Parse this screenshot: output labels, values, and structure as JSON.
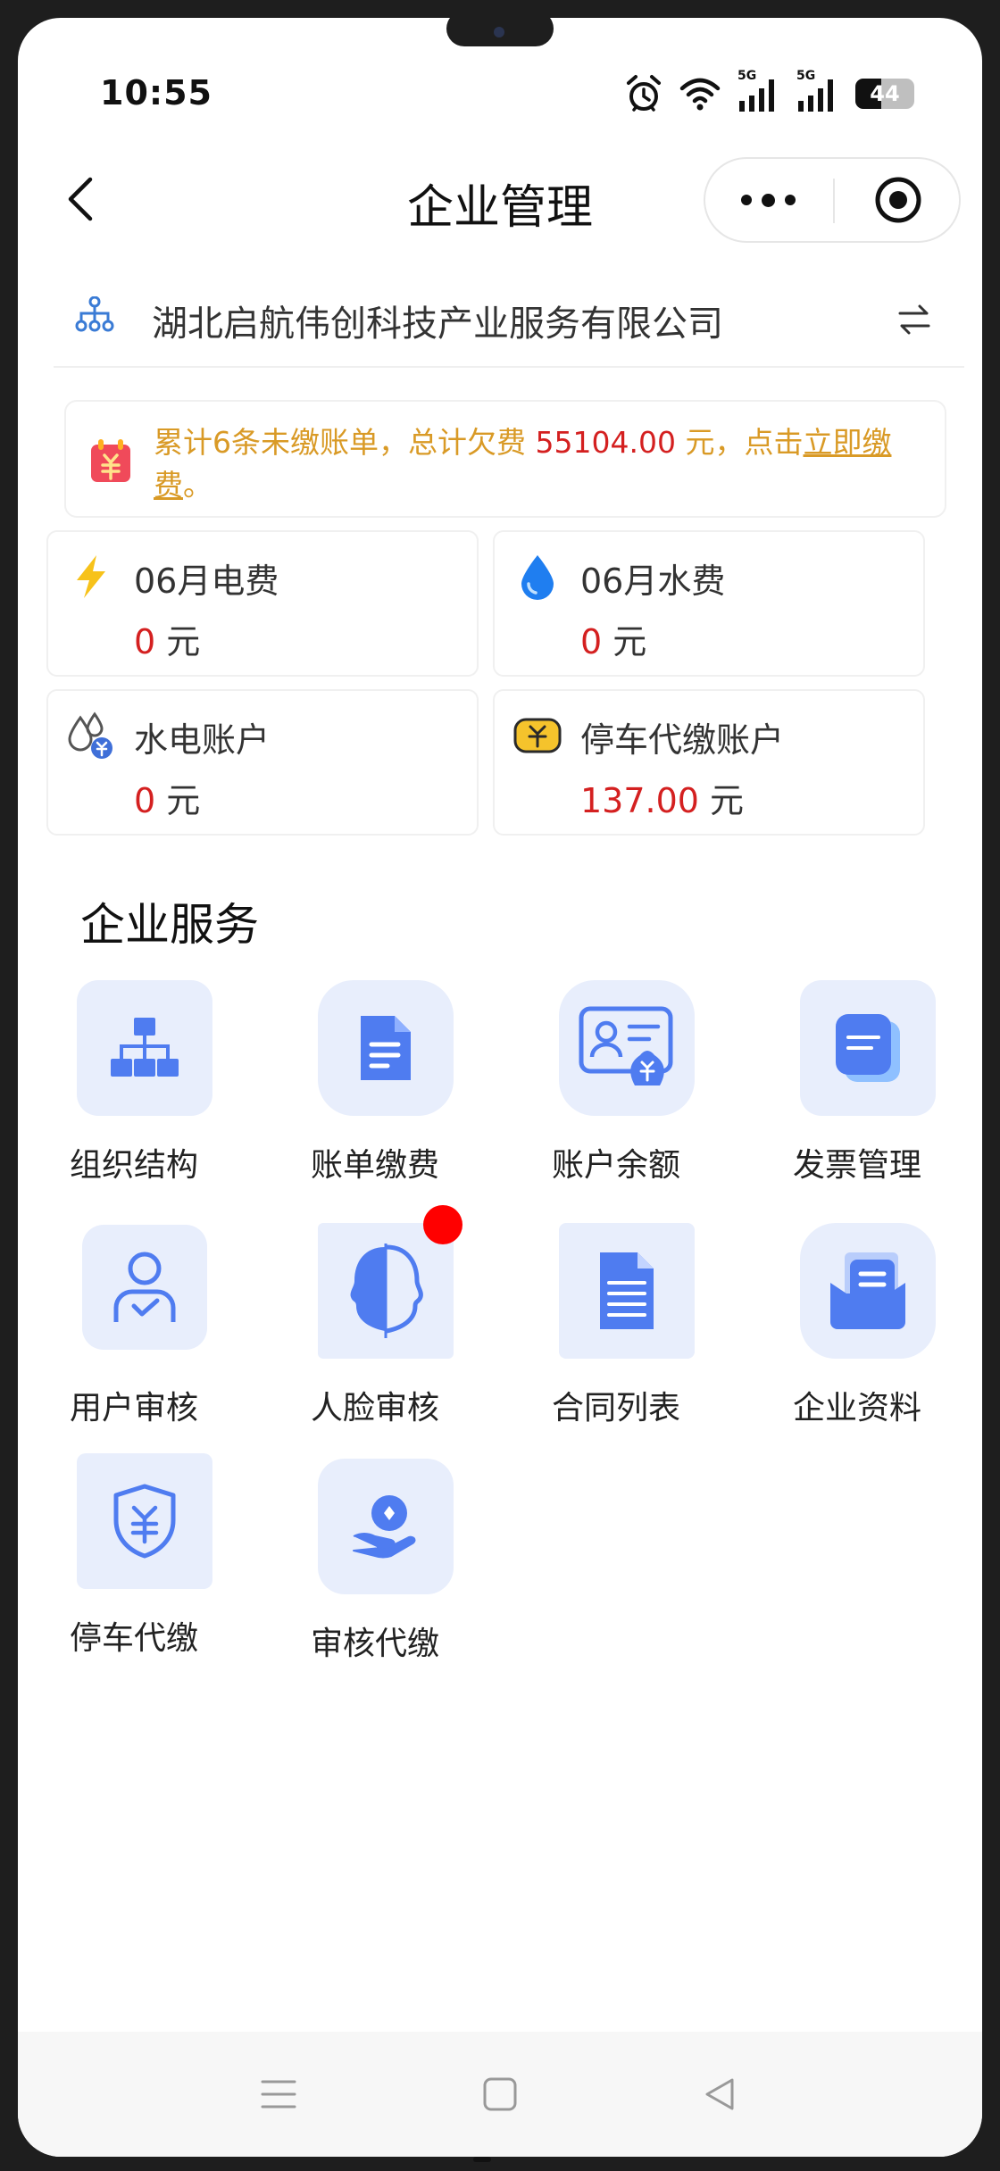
{
  "status_bar": {
    "time": "10:55",
    "net1": "5G",
    "net2": "5G",
    "battery": "44",
    "icons": [
      "alarm-icon",
      "wifi-icon",
      "signal-5g-icon",
      "signal-5g-icon",
      "battery-icon"
    ]
  },
  "nav": {
    "title": "企业管理",
    "back_icon": "chevron-left-icon",
    "more_icon": "more-dots-icon",
    "close_icon": "target-close-icon"
  },
  "company": {
    "name": "湖北启航伟创科技产业服务有限公司",
    "icon": "org-tree-icon",
    "switch_icon": "switch-arrows-icon"
  },
  "notice": {
    "prefix": "累计6条未缴账单，总计欠费 ",
    "amount": "55104.00",
    "middle": " 元，点击",
    "link": "立即缴费",
    "suffix": "。",
    "icon": "bill-calendar-icon"
  },
  "cards": [
    {
      "title": "06月电费",
      "value": "0",
      "unit": " 元",
      "icon": "lightning-icon"
    },
    {
      "title": "06月水费",
      "value": "0",
      "unit": " 元",
      "icon": "water-drop-icon"
    },
    {
      "title": "水电账户",
      "value": "0",
      "unit": " 元",
      "icon": "water-electric-account-icon"
    },
    {
      "title": "停车代缴账户",
      "value": "137.00",
      "unit": " 元",
      "icon": "parking-wallet-icon"
    }
  ],
  "services": {
    "title": "企业服务",
    "items": [
      {
        "label": "组织结构",
        "icon": "org-structure-icon"
      },
      {
        "label": "账单缴费",
        "icon": "bill-document-icon"
      },
      {
        "label": "账户余额",
        "icon": "account-balance-icon"
      },
      {
        "label": "发票管理",
        "icon": "invoice-icon"
      },
      {
        "label": "用户审核",
        "icon": "user-check-icon"
      },
      {
        "label": "人脸审核",
        "icon": "face-icon"
      },
      {
        "label": "合同列表",
        "icon": "contract-icon"
      },
      {
        "label": "企业资料",
        "icon": "enterprise-docs-icon"
      },
      {
        "label": "停车代缴",
        "icon": "shield-yuan-icon"
      },
      {
        "label": "审核代缴",
        "icon": "hand-coin-icon"
      }
    ]
  },
  "colors": {
    "accent_blue": "#4f7cf0",
    "tile_bg": "#e8eefc",
    "warning_text": "#d99a26",
    "amount_red": "#d42020"
  }
}
